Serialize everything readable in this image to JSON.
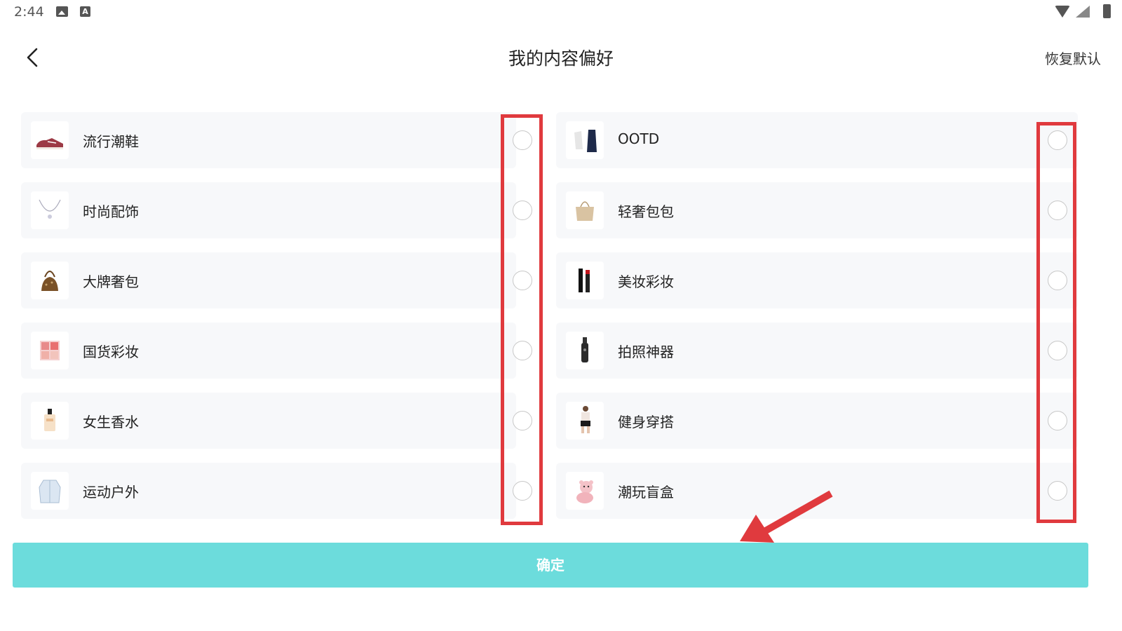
{
  "status_bar": {
    "time": "2:44",
    "icons": [
      "image-icon",
      "a-icon",
      "wifi-icon",
      "signal-icon",
      "battery-icon"
    ]
  },
  "header": {
    "title": "我的内容偏好",
    "reset_label": "恢复默认",
    "back_icon": "chevron-left-icon"
  },
  "left_items": [
    {
      "label": "流行潮鞋",
      "icon": "sneaker-icon",
      "selected": false
    },
    {
      "label": "时尚配饰",
      "icon": "necklace-icon",
      "selected": false
    },
    {
      "label": "大牌奢包",
      "icon": "handbag-icon",
      "selected": false
    },
    {
      "label": "国货彩妆",
      "icon": "palette-icon",
      "selected": false
    },
    {
      "label": "女生香水",
      "icon": "perfume-icon",
      "selected": false
    },
    {
      "label": "运动户外",
      "icon": "jacket-icon",
      "selected": false
    }
  ],
  "right_items": [
    {
      "label": "OOTD",
      "icon": "outfit-icon",
      "selected": false
    },
    {
      "label": "轻奢包包",
      "icon": "tote-bag-icon",
      "selected": false
    },
    {
      "label": "美妆彩妆",
      "icon": "makeup-icon",
      "selected": false
    },
    {
      "label": "拍照神器",
      "icon": "camera-gimbal-icon",
      "selected": false
    },
    {
      "label": "健身穿搭",
      "icon": "fitness-outfit-icon",
      "selected": false
    },
    {
      "label": "潮玩盲盒",
      "icon": "plush-toy-icon",
      "selected": false
    }
  ],
  "confirm_label": "确定",
  "colors": {
    "accent": "#6cdcdc",
    "highlight": "#e03a3e",
    "card_bg": "#f7f8fa"
  }
}
